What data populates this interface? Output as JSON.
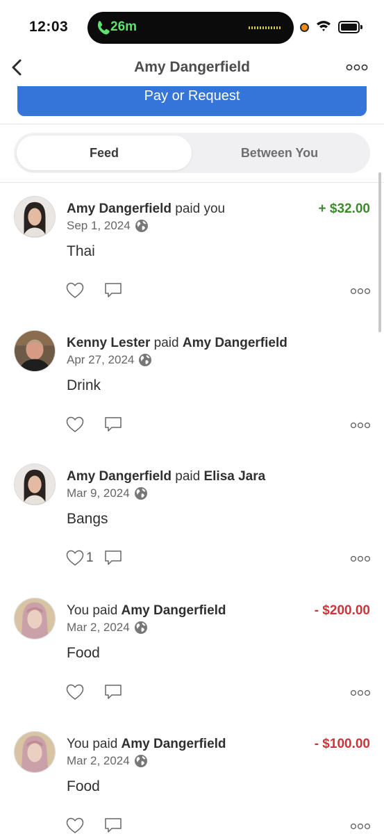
{
  "status_bar": {
    "time": "12:03",
    "call_duration": "26m",
    "call_color": "#5ee26e",
    "icons": [
      "phone-icon",
      "recording-dot-icon",
      "wifi-icon",
      "battery-icon"
    ]
  },
  "header": {
    "title": "Amy Dangerfield",
    "back_icon": "chevron-left-icon",
    "more_icon": "more-horizontal-icon"
  },
  "pay_button": {
    "label": "Pay or Request",
    "color": "#3574d9"
  },
  "tabs": {
    "feed": "Feed",
    "between": "Between You",
    "selected": "Feed"
  },
  "feed": [
    {
      "parts": [
        "Amy Dangerfield",
        " paid you"
      ],
      "date": "Sep 1, 2024",
      "note": "Thai",
      "amount": "+ $32.00",
      "amount_type": "positive",
      "likes": "",
      "avatar": "avatar-woman-dark-hair"
    },
    {
      "parts": [
        "Kenny Lester",
        " paid ",
        "Amy Dangerfield"
      ],
      "date": "Apr 27, 2024",
      "note": "Drink",
      "amount": "",
      "amount_type": "none",
      "likes": "",
      "avatar": "avatar-man"
    },
    {
      "parts": [
        "Amy Dangerfield",
        " paid ",
        "Elisa Jara"
      ],
      "date": "Mar 9, 2024",
      "note": "Bangs",
      "amount": "",
      "amount_type": "none",
      "likes": "1",
      "avatar": "avatar-woman-dark-hair"
    },
    {
      "parts": [
        "You paid ",
        "Amy Dangerfield"
      ],
      "date": "Mar 2, 2024",
      "note": "Food",
      "amount": "- $200.00",
      "amount_type": "negative",
      "likes": "",
      "avatar": "avatar-self-pink-hair"
    },
    {
      "parts": [
        "You paid ",
        "Amy Dangerfield"
      ],
      "date": "Mar 2, 2024",
      "note": "Food",
      "amount": "- $100.00",
      "amount_type": "negative",
      "likes": "",
      "avatar": "avatar-self-pink-hair"
    }
  ],
  "colors": {
    "positive": "#3c8a2e",
    "negative": "#d0343a"
  }
}
